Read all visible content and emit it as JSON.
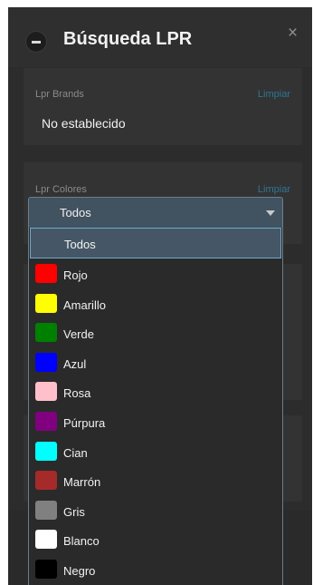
{
  "header": {
    "title": "Búsqueda LPR",
    "close_symbol": "×"
  },
  "brands": {
    "label": "Lpr Brands",
    "clear_label": "Limpiar",
    "value": "No establecido"
  },
  "colores": {
    "label": "Lpr Colores",
    "clear_label": "Limpiar",
    "selected": "Todos"
  },
  "dropdown": {
    "options": [
      {
        "label": "Todos",
        "color": null
      },
      {
        "label": "Rojo",
        "color": "#ff0000"
      },
      {
        "label": "Amarillo",
        "color": "#ffff00"
      },
      {
        "label": "Verde",
        "color": "#008000"
      },
      {
        "label": "Azul",
        "color": "#0000ff"
      },
      {
        "label": "Rosa",
        "color": "#ffc0cb"
      },
      {
        "label": "Púrpura",
        "color": "#800080"
      },
      {
        "label": "Cian",
        "color": "#00ffff"
      },
      {
        "label": "Marrón",
        "color": "#a52a2a"
      },
      {
        "label": "Gris",
        "color": "#808080"
      },
      {
        "label": "Blanco",
        "color": "#ffffff"
      },
      {
        "label": "Negro",
        "color": "#000000"
      }
    ]
  }
}
